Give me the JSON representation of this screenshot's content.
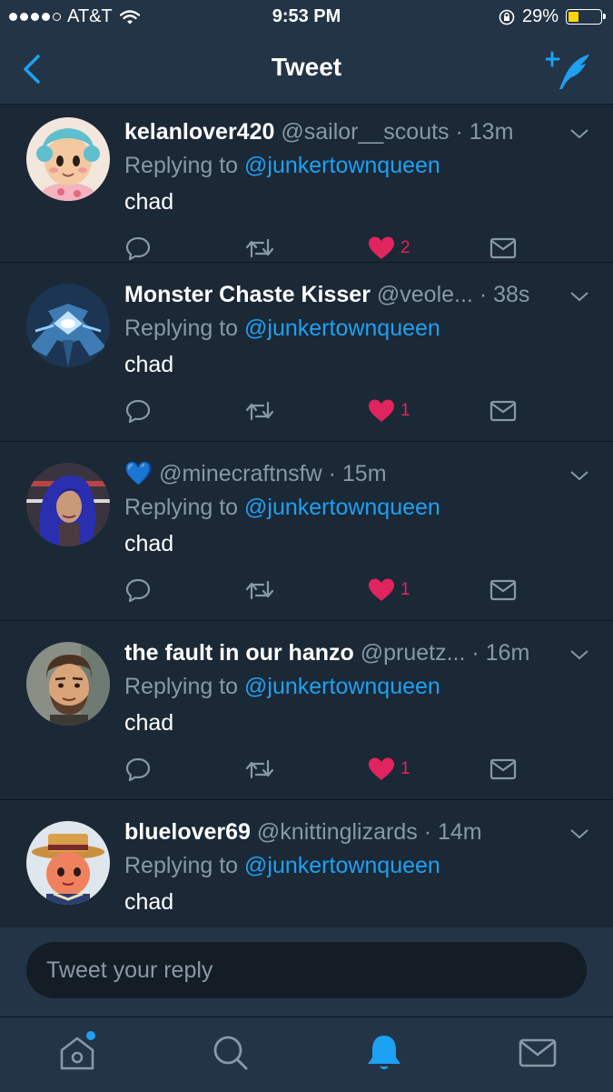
{
  "status_bar": {
    "carrier": "AT&T",
    "time": "9:53 PM",
    "battery": "29%",
    "battery_level": 0.29
  },
  "nav": {
    "title": "Tweet"
  },
  "tweets": [
    {
      "name": "kelanlover420",
      "handle": "@sailor__scouts",
      "time": "13m",
      "reply_prefix": "Replying to",
      "reply_to": "@junkertownqueen",
      "text": "chad",
      "likes": "2"
    },
    {
      "name": "Monster Chaste Kisser",
      "handle": "@veole...",
      "time": "38s",
      "reply_prefix": "Replying to",
      "reply_to": "@junkertownqueen",
      "text": "chad",
      "likes": "1"
    },
    {
      "name": "💙",
      "handle": "@minecraftnsfw",
      "time": "15m",
      "reply_prefix": "Replying to",
      "reply_to": "@junkertownqueen",
      "text": "chad",
      "likes": "1"
    },
    {
      "name": "the fault in our hanzo",
      "handle": "@pruetz...",
      "time": "16m",
      "reply_prefix": "Replying to",
      "reply_to": "@junkertownqueen",
      "text": "chad",
      "likes": "1"
    },
    {
      "name": "bluelover69",
      "handle": "@knittinglizards",
      "time": "14m",
      "reply_prefix": "Replying to",
      "reply_to": "@junkertownqueen",
      "text": "chad",
      "likes": ""
    }
  ],
  "reply_box": {
    "placeholder": "Tweet your reply"
  },
  "tabs": [
    {
      "icon": "home-icon"
    },
    {
      "icon": "search-icon"
    },
    {
      "icon": "notifications-icon",
      "active": true
    },
    {
      "icon": "messages-icon"
    }
  ],
  "colors": {
    "background": "#1b2836",
    "bar": "#243447",
    "accent": "#1da1f2",
    "secondary_text": "#8899a6",
    "like": "#e0245e"
  }
}
